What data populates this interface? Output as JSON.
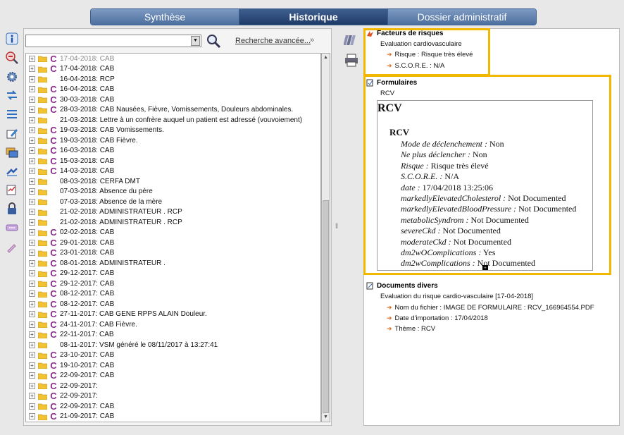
{
  "tabs": [
    "Synthèse",
    "Historique",
    "Dossier administratif"
  ],
  "active_tab": 1,
  "search": {
    "advanced_label": "Recherche avancée...",
    "chevron": "»"
  },
  "tree_rows": [
    {
      "mark": "C",
      "text": "17-04-2018: CAB"
    },
    {
      "mark": "C",
      "text": "17-04-2018: CAB"
    },
    {
      "mark": "",
      "text": "16-04-2018:  RCP"
    },
    {
      "mark": "C",
      "text": "16-04-2018: CAB"
    },
    {
      "mark": "C",
      "text": "30-03-2018: CAB"
    },
    {
      "mark": "C",
      "text": "28-03-2018: CAB  Nausées, Fièvre, Vomissements, Douleurs abdominales."
    },
    {
      "mark": "",
      "text": "21-03-2018:  Lettre à un confrère auquel un patient est adressé (vouvoiement)"
    },
    {
      "mark": "C",
      "text": "19-03-2018: CAB  Vomissements."
    },
    {
      "mark": "C",
      "text": "19-03-2018: CAB  Fièvre."
    },
    {
      "mark": "C",
      "text": "16-03-2018: CAB"
    },
    {
      "mark": "C",
      "text": "15-03-2018: CAB"
    },
    {
      "mark": "C",
      "text": "14-03-2018: CAB"
    },
    {
      "mark": "",
      "text": "08-03-2018:   CERFA DMT"
    },
    {
      "mark": "",
      "text": "07-03-2018:   Absence du père"
    },
    {
      "mark": "",
      "text": "07-03-2018:   Absence de la mère"
    },
    {
      "mark": "",
      "text": "21-02-2018:  ADMINISTRATEUR . RCP"
    },
    {
      "mark": "",
      "text": "21-02-2018:  ADMINISTRATEUR . RCP"
    },
    {
      "mark": "C",
      "text": "02-02-2018: CAB"
    },
    {
      "mark": "C",
      "text": "29-01-2018: CAB"
    },
    {
      "mark": "C",
      "text": "23-01-2018: CAB"
    },
    {
      "mark": "C",
      "text": "08-01-2018: ADMINISTRATEUR ."
    },
    {
      "mark": "C",
      "text": "29-12-2017: CAB"
    },
    {
      "mark": "C",
      "text": "29-12-2017: CAB"
    },
    {
      "mark": "C",
      "text": "08-12-2017: CAB"
    },
    {
      "mark": "C",
      "text": "08-12-2017: CAB"
    },
    {
      "mark": "C",
      "text": "27-11-2017: CAB GENE RPPS ALAIN Douleur."
    },
    {
      "mark": "C",
      "text": "24-11-2017: CAB  Fièvre."
    },
    {
      "mark": "C",
      "text": "22-11-2017: CAB"
    },
    {
      "mark": "",
      "text": "08-11-2017:   VSM généré le 08/11/2017 à 13:27:41"
    },
    {
      "mark": "C",
      "text": "23-10-2017: CAB"
    },
    {
      "mark": "C",
      "text": "19-10-2017: CAB"
    },
    {
      "mark": "C",
      "text": "22-09-2017: CAB"
    },
    {
      "mark": "C",
      "text": "22-09-2017:"
    },
    {
      "mark": "C",
      "text": "22-09-2017:"
    },
    {
      "mark": "C",
      "text": "22-09-2017: CAB"
    },
    {
      "mark": "C",
      "text": "21-09-2017: CAB"
    }
  ],
  "risk": {
    "title": "Facteurs de risques",
    "subtitle": "Evaluation cardiovasculaire",
    "items": [
      "Risque : Risque très élevé",
      "S.C.O.R.E. : N/A"
    ]
  },
  "forms": {
    "title": "Formulaires",
    "subtitle": "RCV",
    "h1": "RCV",
    "h2": "RCV",
    "fields": [
      {
        "label": "Mode de déclenchement :",
        "value": "Non"
      },
      {
        "label": "Ne plus déclencher :",
        "value": "Non"
      },
      {
        "label": "Risque :",
        "value": "Risque très élevé"
      },
      {
        "label": "S.C.O.R.E. :",
        "value": "N/A"
      },
      {
        "label": "date :",
        "value": "17/04/2018 13:25:06"
      },
      {
        "label": "markedlyElevatedCholesterol :",
        "value": "Not Documented"
      },
      {
        "label": "markedlyElevatedBloodPressure :",
        "value": "Not Documented"
      },
      {
        "label": "metabolicSyndrom :",
        "value": "Not Documented"
      },
      {
        "label": "severeCkd :",
        "value": "Not Documented"
      },
      {
        "label": "moderateCkd :",
        "value": "Not Documented"
      },
      {
        "label": "dm2wOComplications :",
        "value": "Yes"
      },
      {
        "label": "dm2wComplications :",
        "value": "Not Documented"
      }
    ]
  },
  "docs": {
    "title": "Documents divers",
    "subtitle": "Evaluation du risque cardio-vasculaire [17-04-2018]",
    "items": [
      "Nom du fichier : IMAGE DE FORMULAIRE : RCV_166964554.PDF",
      "Date d'importation : 17/04/2018",
      "Thème : RCV"
    ]
  },
  "colors": {
    "highlight": "#f2b800",
    "tab_active": "#1f3b68",
    "c_mark": "#8a2b8a",
    "arrow": "#e07020"
  },
  "icons": [
    "info-icon",
    "zoom-out-icon",
    "settings-icon",
    "transfer-icon",
    "list-icon",
    "edit-icon",
    "cards-icon",
    "prescription-icon",
    "chart-edit-icon",
    "lock-icon",
    "message-icon",
    "brush-icon"
  ]
}
